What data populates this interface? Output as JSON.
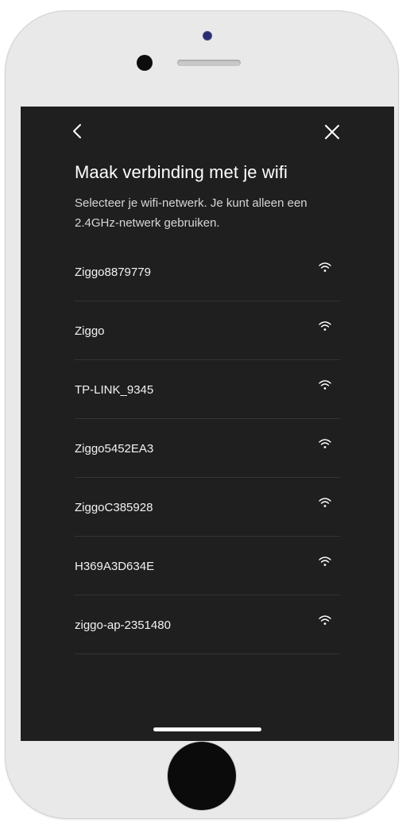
{
  "header": {
    "back_icon": "chevron-left-icon",
    "close_icon": "close-icon"
  },
  "title": "Maak verbinding met je wifi",
  "subtitle": "Selecteer je wifi-netwerk. Je kunt alleen een 2.4GHz-netwerk gebruiken.",
  "networks": [
    {
      "name": "Ziggo8879779",
      "icon": "wifi-icon"
    },
    {
      "name": "Ziggo",
      "icon": "wifi-icon"
    },
    {
      "name": "TP-LINK_9345",
      "icon": "wifi-icon"
    },
    {
      "name": "Ziggo5452EA3",
      "icon": "wifi-icon"
    },
    {
      "name": "ZiggoC385928",
      "icon": "wifi-icon"
    },
    {
      "name": "H369A3D634E",
      "icon": "wifi-icon"
    },
    {
      "name": "ziggo-ap-2351480",
      "icon": "wifi-icon"
    }
  ],
  "colors": {
    "screen_background": "#1f1f1f",
    "text_primary": "#ffffff",
    "text_secondary": "#d6d6d6",
    "divider": "#333333",
    "phone_body": "#e9e9e9"
  }
}
